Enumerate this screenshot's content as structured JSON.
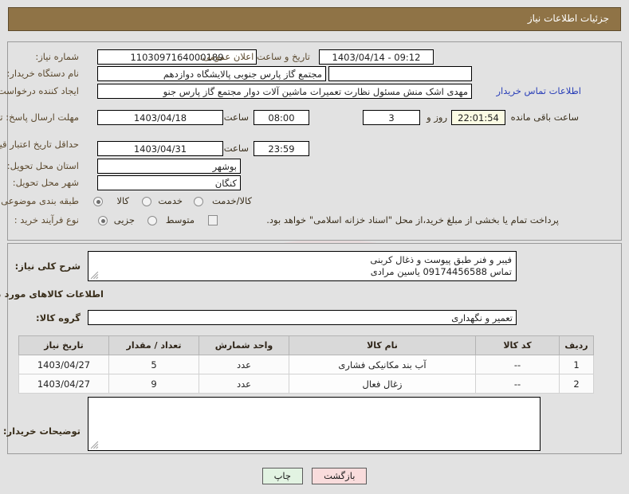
{
  "header": {
    "title": "جزئیات اطلاعات نیاز"
  },
  "form": {
    "need_number_label": "شماره نیاز:",
    "need_number_value": "1103097164000189",
    "public_announce_label": "تاریخ و ساعت اعلان عمومی:",
    "public_announce_value": "1403/04/14 - 09:12",
    "buyer_org_label": "نام دستگاه خریدار:",
    "buyer_org_value": "مجتمع گاز پارس جنوبی  پالایشگاه دوازدهم",
    "creator_label": "ایجاد کننده درخواست:",
    "creator_value": "مهدی اشک منش مسئول نظارت تعمیرات ماشین آلات دوار مجتمع گاز پارس جنو",
    "buyer_contact_link": "اطلاعات تماس خریدار",
    "reply_deadline_label": "مهلت ارسال پاسخ: تا تاریخ:",
    "reply_deadline_date": "1403/04/18",
    "reply_deadline_hour_label": "ساعت",
    "reply_deadline_time": "08:00",
    "remaining_days": "3",
    "remaining_days_label": "روز و",
    "remaining_time": "22:01:54",
    "remaining_time_label": "ساعت باقی مانده",
    "price_validity_label": "حداقل تاریخ اعتبار قیمت: تا تاریخ:",
    "price_validity_date": "1403/04/31",
    "price_validity_hour_label": "ساعت",
    "price_validity_time": "23:59",
    "province_label": "استان محل تحویل:",
    "province_value": "بوشهر",
    "city_label": "شهر محل تحویل:",
    "city_value": "کنگان",
    "category_label": "طبقه بندی موضوعی:",
    "category_options": [
      "کالا",
      "خدمت",
      "کالا/خدمت"
    ],
    "category_selected_index": 0,
    "process_type_label": "نوع فرآیند خرید :",
    "process_type_options": [
      "جزیی",
      "متوسط"
    ],
    "process_type_selected_index": 0,
    "treasury_checkbox_label": "پرداخت تمام یا بخشی از مبلغ خرید،از محل \"اسناد خزانه اسلامی\" خواهد بود.",
    "treasury_checked": false
  },
  "description": {
    "need_summary_label": "شرح کلی نیاز:",
    "need_summary_value": "فیبر و فنر طبق پیوست و ذغال کربنی\nتماس 09174456588 یاسین مرادی",
    "goods_info_title": "اطلاعات کالاهای مورد نیاز",
    "goods_group_label": "گروه کالا:",
    "goods_group_value": "تعمیر و نگهداری",
    "buyer_notes_label": "توضیحات خریدار:",
    "buyer_notes_value": ""
  },
  "table": {
    "headers": [
      "ردیف",
      "کد کالا",
      "نام کالا",
      "واحد شمارش",
      "تعداد / مقدار",
      "تاریخ نیاز"
    ],
    "rows": [
      {
        "row": "1",
        "code": "--",
        "name": "آب بند مکانیکی فشاری",
        "unit": "عدد",
        "qty": "5",
        "date": "1403/04/27"
      },
      {
        "row": "2",
        "code": "--",
        "name": "زغال فعال",
        "unit": "عدد",
        "qty": "9",
        "date": "1403/04/27"
      }
    ]
  },
  "footer": {
    "print_label": "چاپ",
    "back_label": "بازگشت"
  },
  "watermark": {
    "text": "AriaTender.net"
  },
  "colors": {
    "header_bg": "#8f7346",
    "page_bg": "#e2e2e2",
    "link": "#2a3fb8",
    "label": "#5c4a2f",
    "print_btn": "#e2f3e2",
    "back_btn": "#f9dcdc"
  }
}
